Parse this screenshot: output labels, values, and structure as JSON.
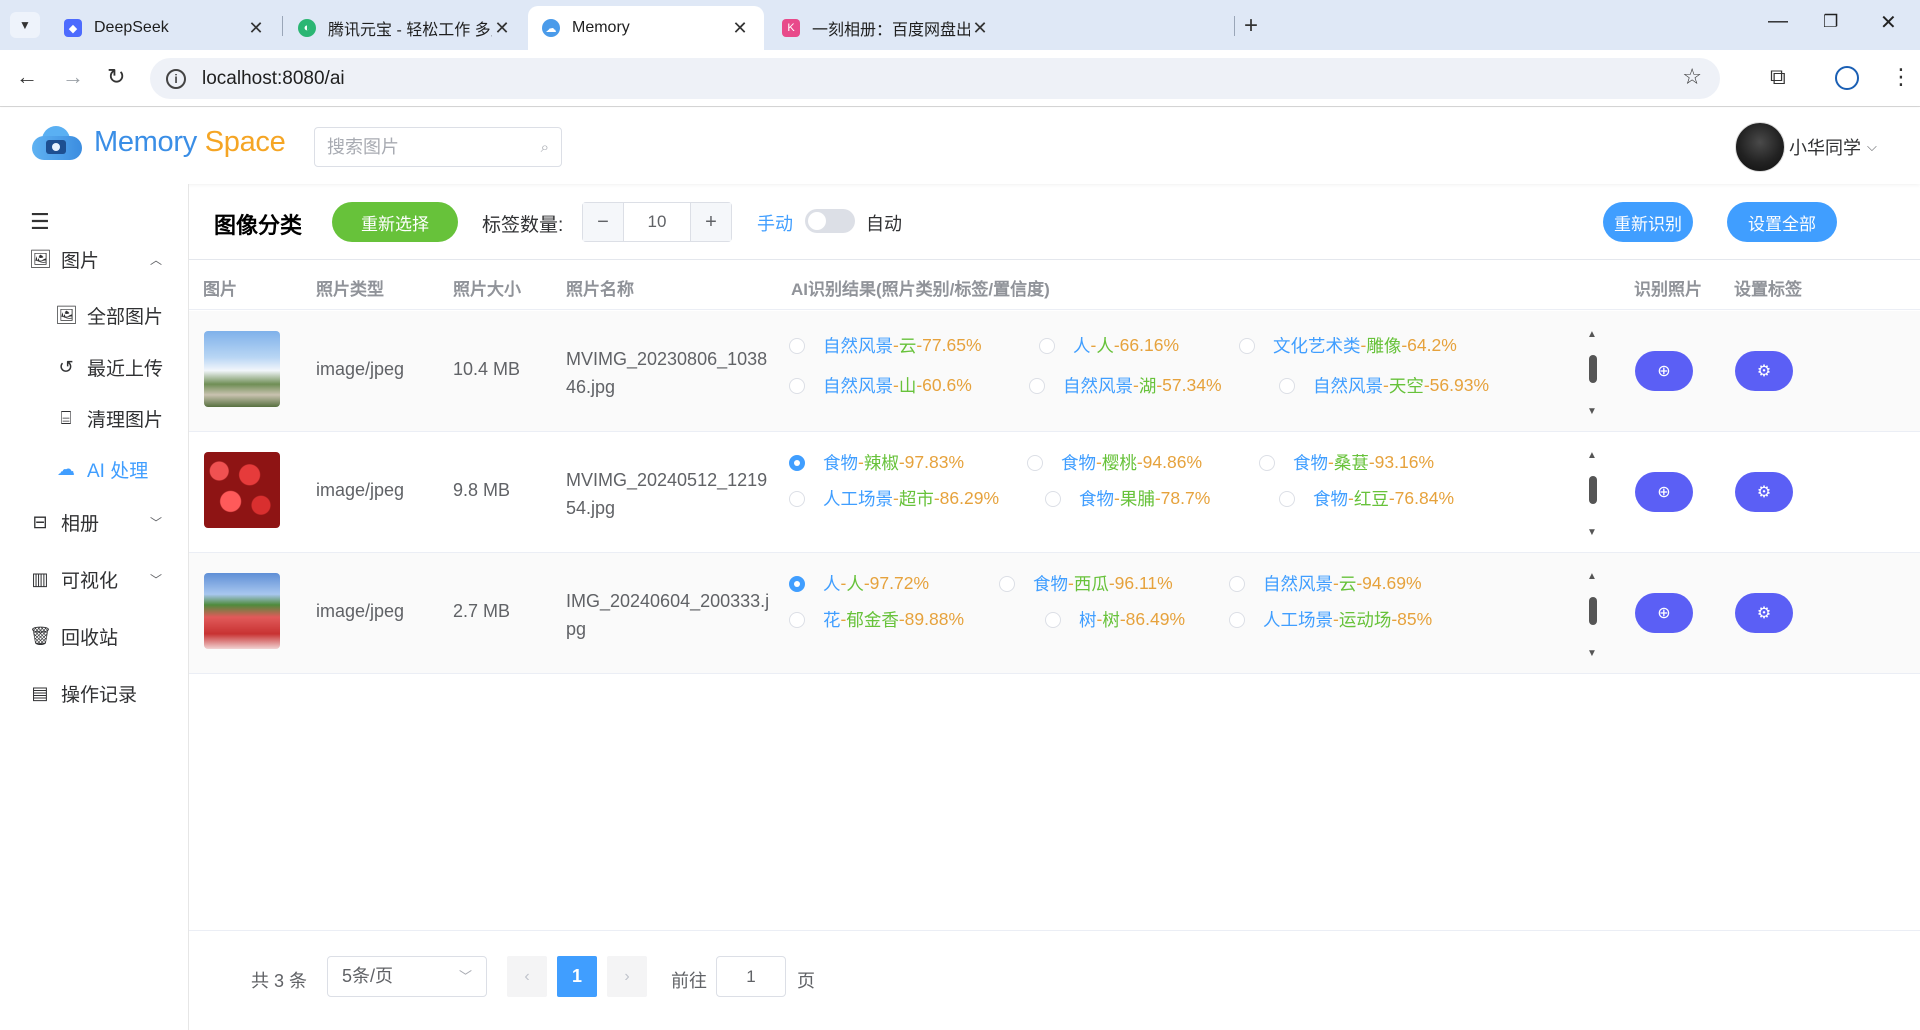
{
  "browser": {
    "tabs": [
      {
        "title": "DeepSeek",
        "favicon": "deepseek-whale",
        "favicon_color": "#4d6bfe"
      },
      {
        "title": "腾讯元宝 - 轻松工作 多点生活",
        "favicon": "yuanbao-leaf",
        "favicon_color": "#2bb673"
      },
      {
        "title": "Memory",
        "favicon": "cloud",
        "favicon_color": "#4a9bea",
        "active": true
      },
      {
        "title": "一刻相册：百度网盘出品，无限",
        "favicon": "yike-k",
        "favicon_color": "#e84a8a"
      }
    ],
    "close_glyph": "✕",
    "new_tab_glyph": "+",
    "url": "localhost:8080/ai"
  },
  "header": {
    "logo_word1": "Memory",
    "logo_word2": "Space",
    "search_placeholder": "搜索图片",
    "user_name": "小华同学"
  },
  "sidebar": {
    "items": [
      {
        "label": "图片",
        "icon": "image-icon"
      },
      {
        "label": "全部图片",
        "icon": "image-icon"
      },
      {
        "label": "最近上传",
        "icon": "history-icon"
      },
      {
        "label": "清理图片",
        "icon": "clean-icon"
      },
      {
        "label": "AI 处理",
        "icon": "cloud-icon",
        "active": true
      },
      {
        "label": "相册",
        "icon": "album-icon"
      },
      {
        "label": "可视化",
        "icon": "chart-icon"
      },
      {
        "label": "回收站",
        "icon": "trash-icon"
      },
      {
        "label": "操作记录",
        "icon": "document-icon"
      }
    ]
  },
  "toolbar": {
    "title": "图像分类",
    "reselect_label": "重新选择",
    "tag_count_label": "标签数量:",
    "tag_count_value": "10",
    "minus_glyph": "−",
    "plus_glyph": "+",
    "switch_left": "手动",
    "switch_right": "自动",
    "switch_on": false,
    "re_recognize_label": "重新识别",
    "set_all_label": "设置全部",
    "colors": {
      "green": "#67c23a",
      "blue": "#409eff",
      "purple": "#5b5ff5"
    }
  },
  "table": {
    "headers": {
      "image": "图片",
      "type": "照片类型",
      "size": "照片大小",
      "name": "照片名称",
      "ai_result": "AI识别结果(照片类别/标签/置信度)",
      "recognize": "识别照片",
      "set_tag": "设置标签"
    },
    "rows": [
      {
        "thumb": "landscape-with-clouds",
        "type": "image/jpeg",
        "size": "10.4 MB",
        "name": "MVIMG_20230806_103846.jpg",
        "results": [
          {
            "category": "自然风景",
            "tag": "云",
            "confidence": "77.65%",
            "selected": false
          },
          {
            "category": "人",
            "tag": "人",
            "confidence": "66.16%",
            "selected": false
          },
          {
            "category": "文化艺术类",
            "tag": "雕像",
            "confidence": "64.2%",
            "selected": false
          },
          {
            "category": "自然风景",
            "tag": "山",
            "confidence": "60.6%",
            "selected": false
          },
          {
            "category": "自然风景",
            "tag": "湖",
            "confidence": "57.34%",
            "selected": false
          },
          {
            "category": "自然风景",
            "tag": "天空",
            "confidence": "56.93%",
            "selected": false
          }
        ]
      },
      {
        "thumb": "cherries",
        "type": "image/jpeg",
        "size": "9.8 MB",
        "name": "MVIMG_20240512_121954.jpg",
        "results": [
          {
            "category": "食物",
            "tag": "辣椒",
            "confidence": "97.83%",
            "selected": true
          },
          {
            "category": "食物",
            "tag": "樱桃",
            "confidence": "94.86%",
            "selected": false
          },
          {
            "category": "食物",
            "tag": "桑葚",
            "confidence": "93.16%",
            "selected": false
          },
          {
            "category": "人工场景",
            "tag": "超市",
            "confidence": "86.29%",
            "selected": false
          },
          {
            "category": "食物",
            "tag": "果脯",
            "confidence": "78.7%",
            "selected": false
          },
          {
            "category": "食物",
            "tag": "红豆",
            "confidence": "76.84%",
            "selected": false
          }
        ]
      },
      {
        "thumb": "watermelon-sports-field",
        "type": "image/jpeg",
        "size": "2.7 MB",
        "name": "IMG_20240604_200333.jpg",
        "results": [
          {
            "category": "人",
            "tag": "人",
            "confidence": "97.72%",
            "selected": true
          },
          {
            "category": "食物",
            "tag": "西瓜",
            "confidence": "96.11%",
            "selected": false
          },
          {
            "category": "自然风景",
            "tag": "云",
            "confidence": "94.69%",
            "selected": false
          },
          {
            "category": "花",
            "tag": "郁金香",
            "confidence": "89.88%",
            "selected": false
          },
          {
            "category": "树",
            "tag": "树",
            "confidence": "86.49%",
            "selected": false
          },
          {
            "category": "人工场景",
            "tag": "运动场",
            "confidence": "85%",
            "selected": false
          }
        ]
      }
    ],
    "row_actions": {
      "recognize_icon": "zoom-in-icon",
      "set_tag_icon": "gear-icon"
    }
  },
  "pagination": {
    "total": "共 3 条",
    "page_size": "5条/页",
    "current_page": "1",
    "goto_label": "前往",
    "goto_value": "1",
    "page_suffix": "页"
  }
}
